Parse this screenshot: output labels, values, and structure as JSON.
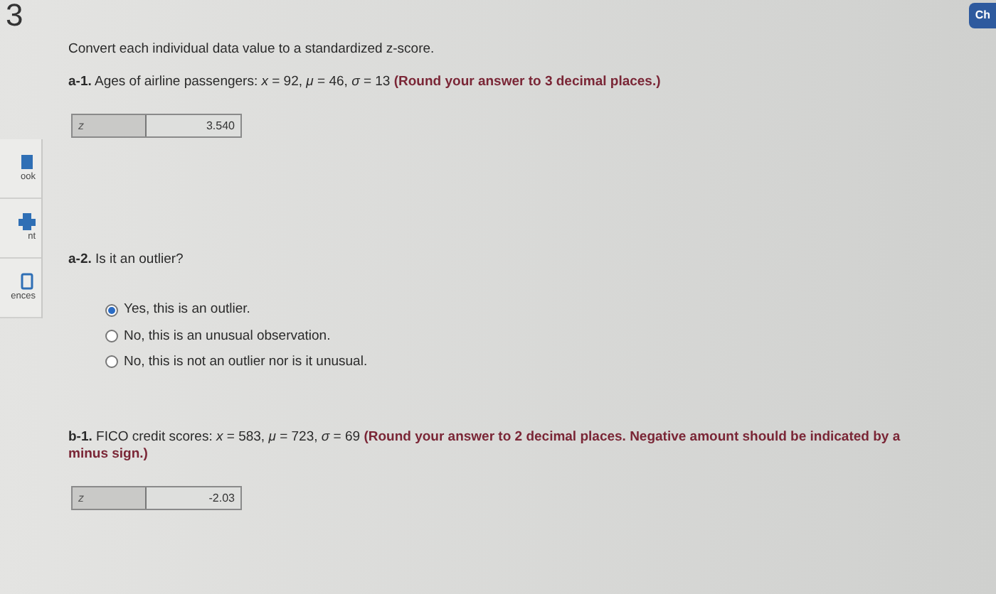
{
  "question_number": "3",
  "sidebar": {
    "items": [
      {
        "label": "ook",
        "kind": "book"
      },
      {
        "label": "nt",
        "kind": "print"
      },
      {
        "label": "ences",
        "kind": "references"
      }
    ]
  },
  "top_button": {
    "label": "Ch"
  },
  "intro": "Convert each individual data value to a standardized z-score.",
  "parts": [
    {
      "kind": "numeric",
      "label": "a-1.",
      "text": "Ages of airline passengers: *x* = 92, *μ* = 46, *σ* = 13 **(Round your answer to 3 decimal places.)**",
      "field_label": "z",
      "value": "3.540"
    },
    {
      "kind": "choice",
      "label": "a-2.",
      "text": "Is it an outlier?",
      "options": [
        {
          "text": "Yes, this is an outlier.",
          "selected": true
        },
        {
          "text": "No, this is an unusual observation.",
          "selected": false
        },
        {
          "text": "No, this is not an outlier nor is it unusual.",
          "selected": false
        }
      ]
    },
    {
      "kind": "numeric",
      "label": "b-1.",
      "text": "FICO credit scores: *x* = 583, *μ* = 723, *σ* = 69 **(Round your answer to 2 decimal places. Negative amount should be indicated by a minus sign.)**",
      "field_label": "z",
      "value": "-2.03"
    }
  ]
}
